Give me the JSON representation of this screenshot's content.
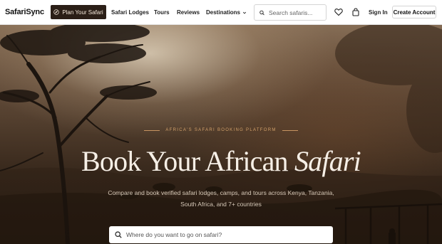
{
  "brand": {
    "name": "SafariSync",
    "accent": "#2b1f17",
    "eyebrow_color": "#d2a06a"
  },
  "nav": {
    "plan_button": "Plan Your Safari",
    "plan_icon": "compass-icon",
    "links": [
      "Safari Lodges",
      "Tours",
      "Reviews",
      "Destinations"
    ],
    "destinations_icon": "chevron-down-icon",
    "search": {
      "placeholder": "Search safaris...",
      "value": ""
    },
    "wishlist_icon": "heart-icon",
    "bag_icon": "shopping-bag-icon",
    "sign_in": "Sign In",
    "create_account": "Create Account"
  },
  "hero": {
    "eyebrow": "AFRICA'S SAFARI BOOKING PLATFORM",
    "headline_main": "Book Your African",
    "headline_italic": "Safari",
    "subtext": "Compare and book verified safari lodges, camps, and tours across Kenya, Tanzania, South Africa, and 7+ countries",
    "search": {
      "placeholder": "Where do you want to go on safari?",
      "value": ""
    }
  }
}
